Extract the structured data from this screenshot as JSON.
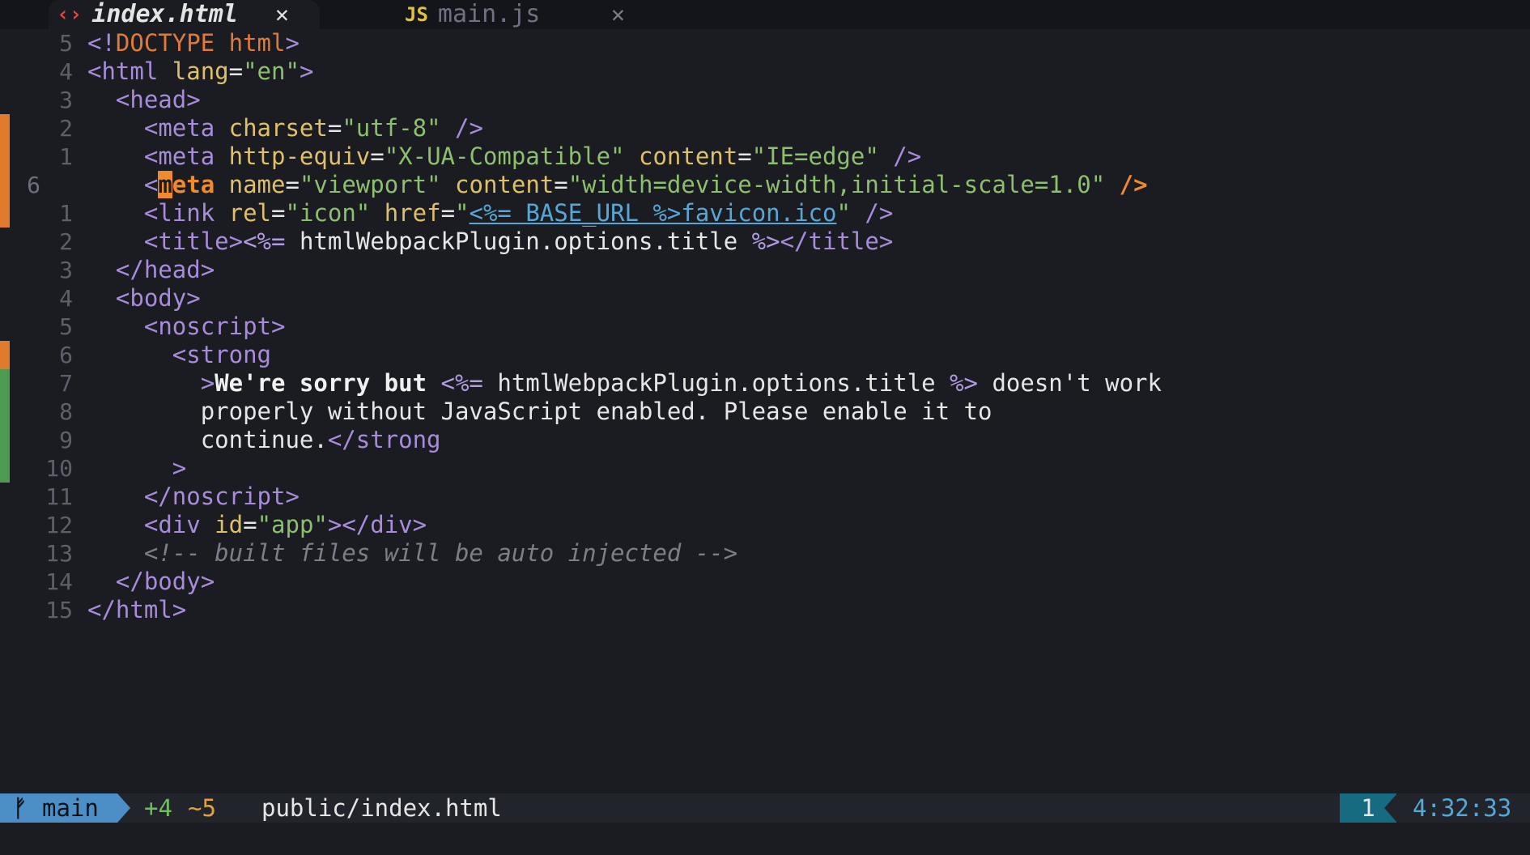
{
  "tabs": [
    {
      "icon": "html-file-icon",
      "label": "index.html",
      "close": "✕",
      "active": true
    },
    {
      "icon": "javascript-file-icon",
      "icon_text": "JS",
      "label": "main.js",
      "close": "✕",
      "active": false
    }
  ],
  "editor": {
    "line_numbers": [
      "5",
      "4",
      "3",
      "2",
      "1",
      "6",
      "1",
      "2",
      "3",
      "4",
      "5",
      "6",
      "7",
      "8",
      "9",
      "10",
      "11",
      "12",
      "13",
      "14",
      "15"
    ],
    "lines": [
      "<!DOCTYPE html>",
      "<html lang=\"en\">",
      "  <head>",
      "    <meta charset=\"utf-8\" />",
      "    <meta http-equiv=\"X-UA-Compatible\" content=\"IE=edge\" />",
      "    <meta name=\"viewport\" content=\"width=device-width,initial-scale=1.0\" />",
      "    <link rel=\"icon\" href=\"<%= BASE_URL %>favicon.ico\" />",
      "    <title><%= htmlWebpackPlugin.options.title %></title>",
      "  </head>",
      "  <body>",
      "    <noscript>",
      "      <strong",
      "        >We're sorry but <%= htmlWebpackPlugin.options.title %> doesn't work",
      "        properly without JavaScript enabled. Please enable it to",
      "        continue.</strong",
      "      >",
      "    </noscript>",
      "    <div id=\"app\"></div>",
      "    <!-- built files will be auto injected -->",
      "  </body>",
      "</html>"
    ],
    "git_gutter": [
      "",
      "",
      "",
      "modified",
      "modified",
      "modified",
      "modified",
      "",
      "",
      "",
      "",
      "modified",
      "added",
      "added",
      "added",
      "added",
      "",
      "",
      "",
      "",
      ""
    ],
    "current_line": 6
  },
  "statusbar": {
    "branch": "main",
    "added": "+4",
    "modified": "~5",
    "filepath": "public/index.html",
    "line_count": "1",
    "clock": "4:32:33"
  },
  "colors": {
    "background": "#1b1c22",
    "branch_bg": "#4c8fc6",
    "linecount_bg": "#176b80",
    "git_modified": "#e07a2c",
    "git_added": "#4f9a52",
    "tag": "#a88cdb",
    "attribute": "#dfc06a",
    "string": "#8cbf6e"
  }
}
